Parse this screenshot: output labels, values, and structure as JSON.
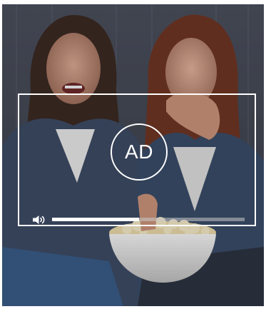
{
  "ad_player": {
    "badge_label": "AD",
    "progress": 0.45,
    "volume_icon": "volume-icon"
  },
  "colors": {
    "overlay_border": "#ffffff",
    "progress_fill": "#ffffff",
    "progress_track": "#c8c8c8"
  }
}
